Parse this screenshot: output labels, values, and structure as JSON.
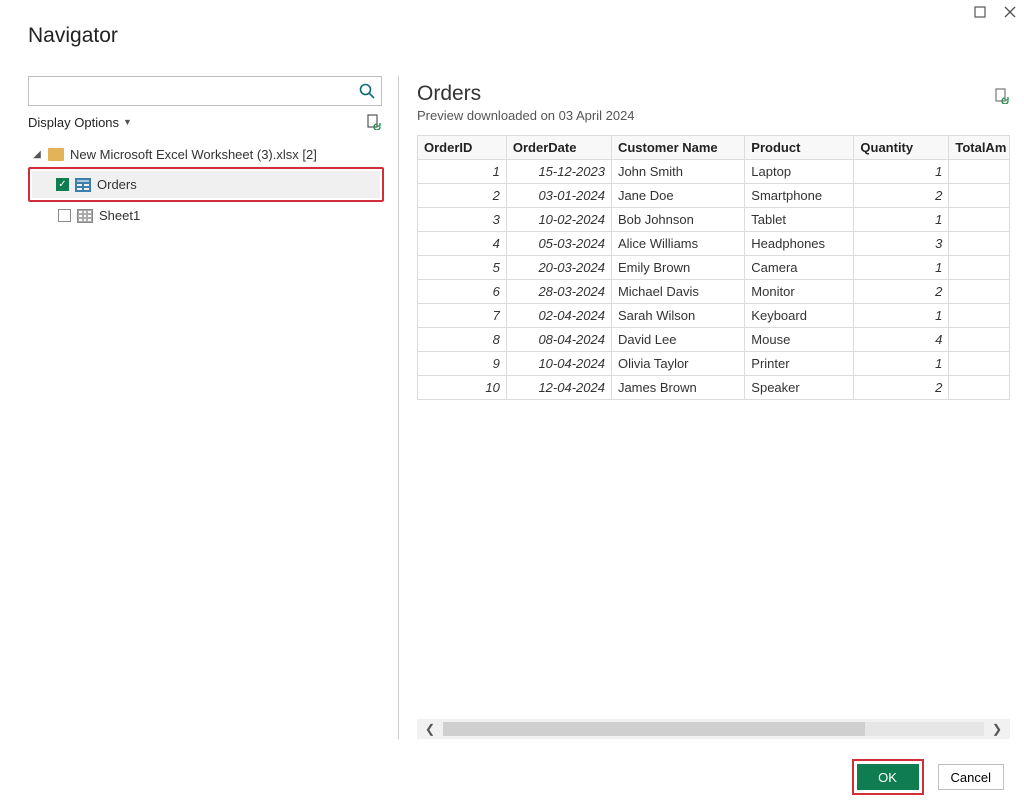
{
  "window": {
    "title": "Navigator"
  },
  "search": {
    "placeholder": ""
  },
  "options": {
    "display_label": "Display Options"
  },
  "tree": {
    "root_label": "New Microsoft Excel Worksheet (3).xlsx [2]",
    "items": [
      {
        "label": "Orders",
        "checked": true,
        "type": "table"
      },
      {
        "label": "Sheet1",
        "checked": false,
        "type": "sheet"
      }
    ]
  },
  "preview": {
    "title": "Orders",
    "subtitle": "Preview downloaded on 03 April 2024",
    "columns": [
      "OrderID",
      "OrderDate",
      "Customer Name",
      "Product",
      "Quantity",
      "TotalAm"
    ],
    "rows": [
      {
        "id": "1",
        "date": "15-12-2023",
        "name": "John Smith",
        "product": "Laptop",
        "qty": "1"
      },
      {
        "id": "2",
        "date": "03-01-2024",
        "name": "Jane Doe",
        "product": "Smartphone",
        "qty": "2"
      },
      {
        "id": "3",
        "date": "10-02-2024",
        "name": "Bob Johnson",
        "product": "Tablet",
        "qty": "1"
      },
      {
        "id": "4",
        "date": "05-03-2024",
        "name": "Alice Williams",
        "product": "Headphones",
        "qty": "3"
      },
      {
        "id": "5",
        "date": "20-03-2024",
        "name": "Emily Brown",
        "product": "Camera",
        "qty": "1"
      },
      {
        "id": "6",
        "date": "28-03-2024",
        "name": "Michael Davis",
        "product": "Monitor",
        "qty": "2"
      },
      {
        "id": "7",
        "date": "02-04-2024",
        "name": "Sarah Wilson",
        "product": "Keyboard",
        "qty": "1"
      },
      {
        "id": "8",
        "date": "08-04-2024",
        "name": "David Lee",
        "product": "Mouse",
        "qty": "4"
      },
      {
        "id": "9",
        "date": "10-04-2024",
        "name": "Olivia Taylor",
        "product": "Printer",
        "qty": "1"
      },
      {
        "id": "10",
        "date": "12-04-2024",
        "name": "James Brown",
        "product": "Speaker",
        "qty": "2"
      }
    ]
  },
  "buttons": {
    "ok": "OK",
    "cancel": "Cancel"
  }
}
